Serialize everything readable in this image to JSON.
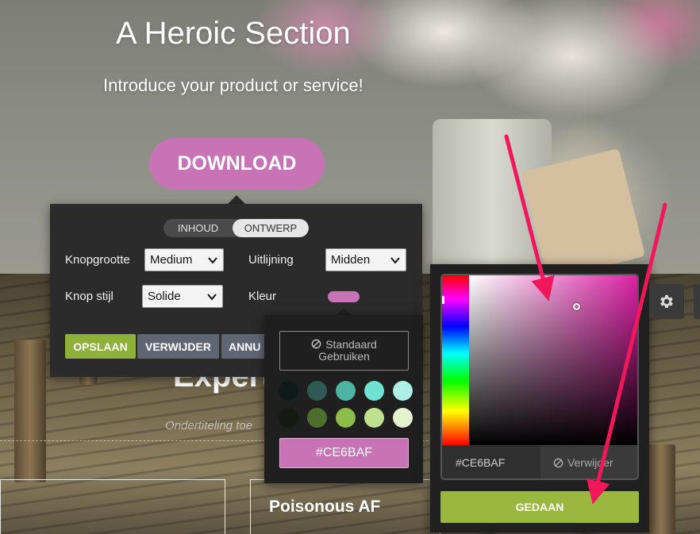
{
  "hero": {
    "title": "A Heroic Section",
    "subtitle": "Introduce your product or service!",
    "download_label": "DOWNLOAD"
  },
  "section": {
    "heading": "Expert",
    "subheading": "Ondertiteling toe",
    "card_title": "Poisonous AF"
  },
  "settings_panel": {
    "tabs": [
      {
        "label": "INHOUD",
        "active": false
      },
      {
        "label": "ONTWERP",
        "active": true
      }
    ],
    "fields": {
      "button_size_label": "Knopgrootte",
      "button_size_value": "Medium",
      "alignment_label": "Uitlijning",
      "alignment_value": "Midden",
      "button_style_label": "Knop stijl",
      "button_style_value": "Solide",
      "color_label": "Kleur"
    },
    "actions": {
      "save": "OPSLAAN",
      "delete": "VERWIJDER",
      "cancel": "ANNU"
    }
  },
  "swatch_panel": {
    "default_line1": "Standaard",
    "default_line2": "Gebruiken",
    "swatches": [
      "#0f1b19",
      "#2f5a53",
      "#4db3a2",
      "#6ee3d1",
      "#aef0e6",
      "#151a12",
      "#4e6e2e",
      "#8ebc4b",
      "#bfe08e",
      "#e6f2cf"
    ],
    "current_hex": "#CE6BAF"
  },
  "color_picker": {
    "hex_value": "#CE6BAF",
    "remove_label": "Verwijder",
    "done_label": "GEDAAN"
  },
  "colors": {
    "button_pink": "#c873b6",
    "accent_green": "#8fb03a",
    "done_green": "#9bb83e",
    "arrow_pink": "#f2175a",
    "panel_dark": "#2b2b2b"
  },
  "icons": {
    "gear": "gear-icon",
    "ban": "ban-icon",
    "chevron": "chevron-down-icon"
  }
}
